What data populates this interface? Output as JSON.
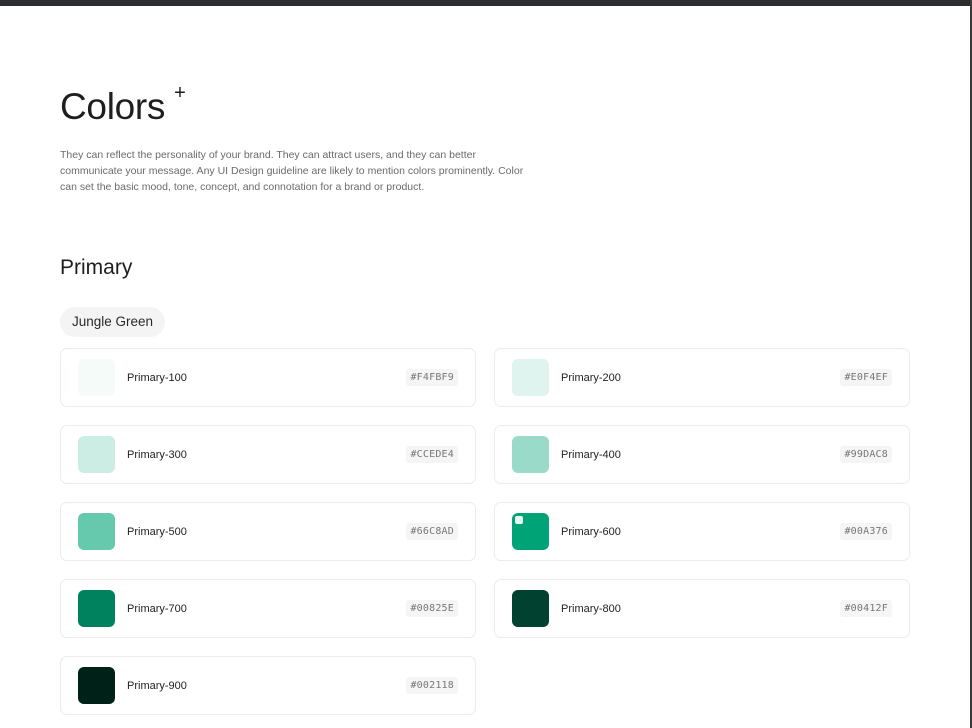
{
  "header": {
    "title": "Colors",
    "plus": "+",
    "description": "They can reflect the personality of your brand. They can attract users, and they can better communicate your message. Any UI Design guideline are likely to mention colors prominently. Color can set the basic mood, tone, concept, and connotation for a brand or product."
  },
  "section": {
    "title": "Primary",
    "chip": "Jungle Green"
  },
  "colors": [
    {
      "name": "Primary-100",
      "hex": "#F4FBF9",
      "swatch": "#F4FBF9"
    },
    {
      "name": "Primary-200",
      "hex": "#E0F4EF",
      "swatch": "#E0F4EF"
    },
    {
      "name": "Primary-300",
      "hex": "#CCEDE4",
      "swatch": "#CCEDE4"
    },
    {
      "name": "Primary-400",
      "hex": "#99DAC8",
      "swatch": "#99DAC8"
    },
    {
      "name": "Primary-500",
      "hex": "#66C8AD",
      "swatch": "#66C8AD"
    },
    {
      "name": "Primary-600",
      "hex": "#00A376",
      "swatch": "#00A376"
    },
    {
      "name": "Primary-700",
      "hex": "#00825E",
      "swatch": "#00825E"
    },
    {
      "name": "Primary-800",
      "hex": "#00412F",
      "swatch": "#00412F"
    },
    {
      "name": "Primary-900",
      "hex": "#002118",
      "swatch": "#002118"
    }
  ]
}
